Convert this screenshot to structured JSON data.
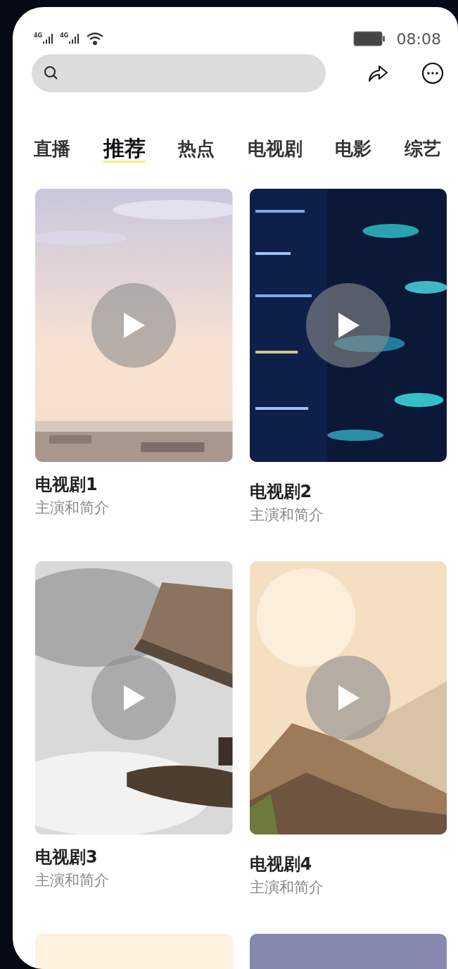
{
  "status_bar": {
    "network_labels": [
      "4G",
      "4G"
    ],
    "time": "08:08"
  },
  "tabs": [
    {
      "label": "直播",
      "selected": false
    },
    {
      "label": "推荐",
      "selected": true
    },
    {
      "label": "热点",
      "selected": false
    },
    {
      "label": "电视剧",
      "selected": false
    },
    {
      "label": "电影",
      "selected": false
    },
    {
      "label": "综艺",
      "selected": false
    }
  ],
  "videos": [
    {
      "title": "电视剧1",
      "subtitle": "主演和简介",
      "kind": "picture"
    },
    {
      "title": "电视剧2",
      "subtitle": "主演和简介",
      "kind": "picture"
    },
    {
      "title": "电视剧3",
      "subtitle": "主演和简介",
      "kind": "picture"
    },
    {
      "title": "电视剧4",
      "subtitle": "主演和简介",
      "kind": "picture"
    }
  ],
  "partial_thumbnails": [
    {
      "color": "#fdf2de"
    },
    {
      "color": "#8688ad"
    }
  ]
}
